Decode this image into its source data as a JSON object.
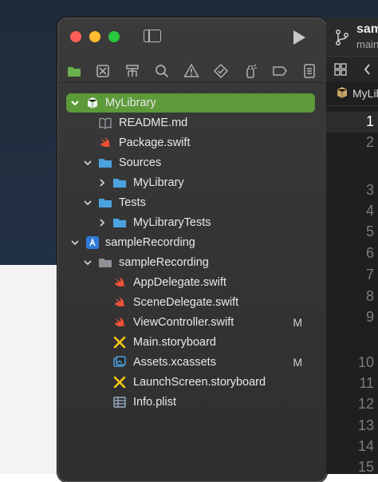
{
  "window": {
    "traffic_lights": [
      "close",
      "minimize",
      "zoom"
    ]
  },
  "navigator_toolbar": {
    "icons": [
      "folder-icon",
      "source-control-icon",
      "symbol-hierarchy-icon",
      "search-icon",
      "warning-icon",
      "test-diamond-icon",
      "debug-spray-icon",
      "breakpoint-tag-icon",
      "report-icon"
    ]
  },
  "tree": {
    "mylibrary_root": "MyLibrary",
    "readme": "README.md",
    "package_swift": "Package.swift",
    "sources": "Sources",
    "sources_mylibrary": "MyLibrary",
    "tests": "Tests",
    "mylibrary_tests": "MyLibraryTests",
    "project": "sampleRecording",
    "group": "sampleRecording",
    "appdelegate": "AppDelegate.swift",
    "scenedelegate": "SceneDelegate.swift",
    "viewcontroller": "ViewController.swift",
    "viewcontroller_status": "M",
    "main_storyboard": "Main.storyboard",
    "assets": "Assets.xcassets",
    "assets_status": "M",
    "launchscreen": "LaunchScreen.storyboard",
    "infoplist": "Info.plist"
  },
  "editor": {
    "scheme": "sam",
    "branch": "main",
    "jump_bar": "MyLib",
    "line_numbers": [
      "1",
      "2",
      "3",
      "4",
      "5",
      "6",
      "7",
      "8",
      "9",
      "10",
      "11",
      "12",
      "13",
      "14",
      "15"
    ],
    "current_line": "1"
  },
  "colors": {
    "selection": "#5d9a3a",
    "folder": "#4aa3df",
    "swift": "#f05138",
    "storyboard": "#f5c518"
  }
}
